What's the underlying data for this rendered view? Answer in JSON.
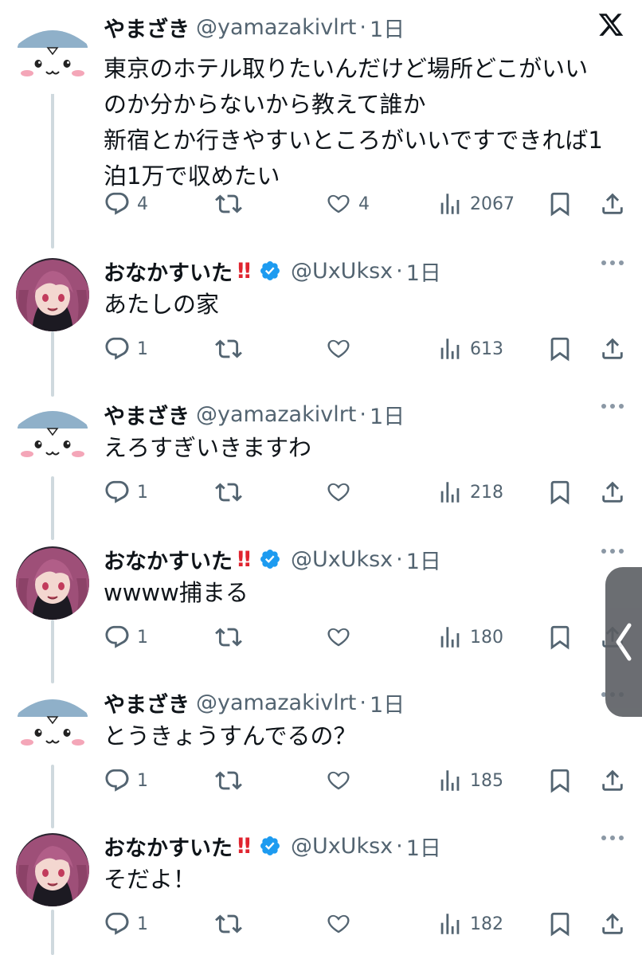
{
  "colors": {
    "text": "#0f1419",
    "secondary": "#536471",
    "verified": "#1d9bf0",
    "bang": "#e0242f",
    "connector": "#cfd9de"
  },
  "tweets": [
    {
      "author": "やまざき",
      "handle": "@yamazakivlrt",
      "dot": "·",
      "time": "1日",
      "text": "東京のホテル取りたいんだけど場所どこがいい\nのか分からないから教えて誰か\n新宿とか行きやすいところがいいですできれば1\n泊1万で収めたい",
      "replies": "4",
      "likes": "4",
      "views": "2067"
    },
    {
      "author": "おなかすいた",
      "badge": "‼",
      "handle": "@UxUksx",
      "dot": "·",
      "time": "1日",
      "text": "あたしの家",
      "replies": "1",
      "views": "613"
    },
    {
      "author": "やまざき",
      "handle": "@yamazakivlrt",
      "dot": "·",
      "time": "1日",
      "text": "えろすぎいきますわ",
      "replies": "1",
      "views": "218"
    },
    {
      "author": "おなかすいた",
      "badge": "‼",
      "handle": "@UxUksx",
      "dot": "·",
      "time": "1日",
      "text": "wwww捕まる",
      "replies": "1",
      "views": "180"
    },
    {
      "author": "やまざき",
      "handle": "@yamazakivlrt",
      "dot": "·",
      "time": "1日",
      "text": "とうきょうすんでるの？",
      "replies": "1",
      "views": "185"
    },
    {
      "author": "おなかすいた",
      "badge": "‼",
      "handle": "@UxUksx",
      "dot": "·",
      "time": "1日",
      "text": "そだよ！",
      "replies": "1",
      "views": "182"
    }
  ],
  "icons": [
    "x-logo-icon",
    "more-icon",
    "reply-icon",
    "retweet-icon",
    "like-icon",
    "views-icon",
    "bookmark-icon",
    "share-icon",
    "verified-icon",
    "chevron-left-icon"
  ]
}
